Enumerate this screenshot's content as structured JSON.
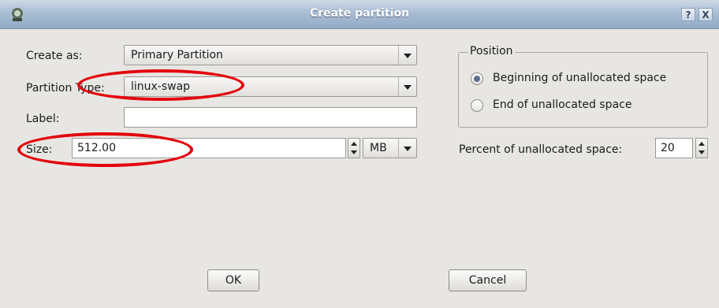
{
  "window": {
    "title": "Create partition",
    "help_label": "?",
    "close_label": "X",
    "icon": "app-icon"
  },
  "form": {
    "create_as": {
      "label": "Create as:",
      "value": "Primary Partition"
    },
    "partition_type": {
      "label": "Partition Type:",
      "value": "linux-swap"
    },
    "label_field": {
      "label": "Label:",
      "value": ""
    },
    "size": {
      "label": "Size:",
      "value": "512.00",
      "unit": "MB"
    }
  },
  "position": {
    "title": "Position",
    "options": [
      {
        "label": "Beginning of unallocated space",
        "selected": true
      },
      {
        "label": "End of unallocated space",
        "selected": false
      }
    ],
    "percent": {
      "label": "Percent of unallocated space:",
      "value": "20"
    }
  },
  "buttons": {
    "ok": "OK",
    "cancel": "Cancel"
  },
  "annotations": {
    "color": "#e3000b"
  }
}
